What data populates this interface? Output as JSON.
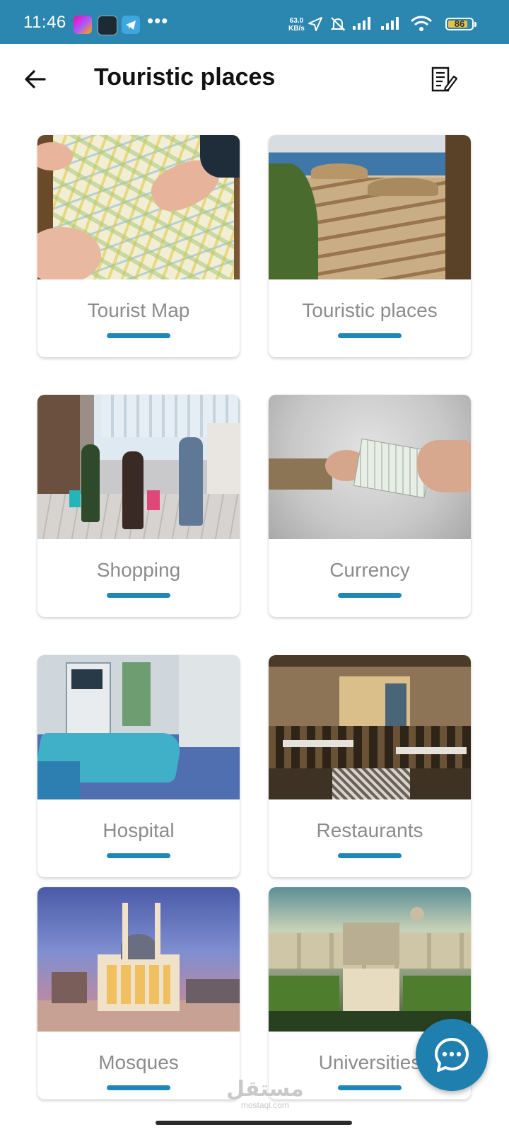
{
  "status_bar": {
    "time": "11:46",
    "more_indicator": "•••",
    "net_speed_value": "63.0",
    "net_speed_unit": "KB/s",
    "battery": "86",
    "battery_level": 0.86,
    "background_color": "#2b86b0"
  },
  "header": {
    "title": "Touristic places",
    "back_icon": "arrow-left-icon",
    "action_icon": "document-edit-icon"
  },
  "categories": [
    {
      "label": "Tourist Map",
      "image": "map-photo"
    },
    {
      "label": "Touristic places",
      "image": "beach-photo"
    },
    {
      "label": "Shopping",
      "image": "shopping-photo"
    },
    {
      "label": "Currency",
      "image": "currency-photo"
    },
    {
      "label": "Hospital",
      "image": "hospital-photo"
    },
    {
      "label": "Restaurants",
      "image": "restaurant-photo"
    },
    {
      "label": "Mosques",
      "image": "mosque-photo"
    },
    {
      "label": "Universities",
      "image": "university-photo"
    }
  ],
  "watermark": {
    "arabic": "مستقل",
    "latin": "mostaql.com"
  },
  "chat_button": {
    "icon": "chat-bubble-icon"
  },
  "accent_color": "#1f87b8"
}
